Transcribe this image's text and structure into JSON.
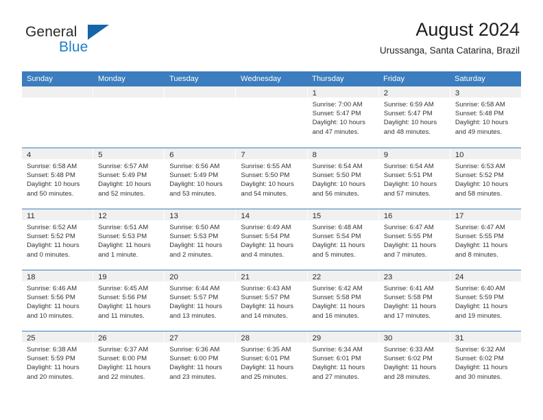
{
  "brand": {
    "general": "General",
    "blue": "Blue",
    "triangle_color": "#1565a8",
    "blue_color": "#1d7ec8"
  },
  "header": {
    "title": "August 2024",
    "subtitle": "Urussanga, Santa Catarina, Brazil",
    "accent_color": "#3b7dbe"
  },
  "weekdays": [
    "Sunday",
    "Monday",
    "Tuesday",
    "Wednesday",
    "Thursday",
    "Friday",
    "Saturday"
  ],
  "weeks": [
    [
      {
        "empty": true
      },
      {
        "empty": true
      },
      {
        "empty": true
      },
      {
        "empty": true
      },
      {
        "day": "1",
        "sunrise": "Sunrise: 7:00 AM",
        "sunset": "Sunset: 5:47 PM",
        "daylight1": "Daylight: 10 hours",
        "daylight2": "and 47 minutes."
      },
      {
        "day": "2",
        "sunrise": "Sunrise: 6:59 AM",
        "sunset": "Sunset: 5:47 PM",
        "daylight1": "Daylight: 10 hours",
        "daylight2": "and 48 minutes."
      },
      {
        "day": "3",
        "sunrise": "Sunrise: 6:58 AM",
        "sunset": "Sunset: 5:48 PM",
        "daylight1": "Daylight: 10 hours",
        "daylight2": "and 49 minutes."
      }
    ],
    [
      {
        "day": "4",
        "sunrise": "Sunrise: 6:58 AM",
        "sunset": "Sunset: 5:48 PM",
        "daylight1": "Daylight: 10 hours",
        "daylight2": "and 50 minutes."
      },
      {
        "day": "5",
        "sunrise": "Sunrise: 6:57 AM",
        "sunset": "Sunset: 5:49 PM",
        "daylight1": "Daylight: 10 hours",
        "daylight2": "and 52 minutes."
      },
      {
        "day": "6",
        "sunrise": "Sunrise: 6:56 AM",
        "sunset": "Sunset: 5:49 PM",
        "daylight1": "Daylight: 10 hours",
        "daylight2": "and 53 minutes."
      },
      {
        "day": "7",
        "sunrise": "Sunrise: 6:55 AM",
        "sunset": "Sunset: 5:50 PM",
        "daylight1": "Daylight: 10 hours",
        "daylight2": "and 54 minutes."
      },
      {
        "day": "8",
        "sunrise": "Sunrise: 6:54 AM",
        "sunset": "Sunset: 5:50 PM",
        "daylight1": "Daylight: 10 hours",
        "daylight2": "and 56 minutes."
      },
      {
        "day": "9",
        "sunrise": "Sunrise: 6:54 AM",
        "sunset": "Sunset: 5:51 PM",
        "daylight1": "Daylight: 10 hours",
        "daylight2": "and 57 minutes."
      },
      {
        "day": "10",
        "sunrise": "Sunrise: 6:53 AM",
        "sunset": "Sunset: 5:52 PM",
        "daylight1": "Daylight: 10 hours",
        "daylight2": "and 58 minutes."
      }
    ],
    [
      {
        "day": "11",
        "sunrise": "Sunrise: 6:52 AM",
        "sunset": "Sunset: 5:52 PM",
        "daylight1": "Daylight: 11 hours",
        "daylight2": "and 0 minutes."
      },
      {
        "day": "12",
        "sunrise": "Sunrise: 6:51 AM",
        "sunset": "Sunset: 5:53 PM",
        "daylight1": "Daylight: 11 hours",
        "daylight2": "and 1 minute."
      },
      {
        "day": "13",
        "sunrise": "Sunrise: 6:50 AM",
        "sunset": "Sunset: 5:53 PM",
        "daylight1": "Daylight: 11 hours",
        "daylight2": "and 2 minutes."
      },
      {
        "day": "14",
        "sunrise": "Sunrise: 6:49 AM",
        "sunset": "Sunset: 5:54 PM",
        "daylight1": "Daylight: 11 hours",
        "daylight2": "and 4 minutes."
      },
      {
        "day": "15",
        "sunrise": "Sunrise: 6:48 AM",
        "sunset": "Sunset: 5:54 PM",
        "daylight1": "Daylight: 11 hours",
        "daylight2": "and 5 minutes."
      },
      {
        "day": "16",
        "sunrise": "Sunrise: 6:47 AM",
        "sunset": "Sunset: 5:55 PM",
        "daylight1": "Daylight: 11 hours",
        "daylight2": "and 7 minutes."
      },
      {
        "day": "17",
        "sunrise": "Sunrise: 6:47 AM",
        "sunset": "Sunset: 5:55 PM",
        "daylight1": "Daylight: 11 hours",
        "daylight2": "and 8 minutes."
      }
    ],
    [
      {
        "day": "18",
        "sunrise": "Sunrise: 6:46 AM",
        "sunset": "Sunset: 5:56 PM",
        "daylight1": "Daylight: 11 hours",
        "daylight2": "and 10 minutes."
      },
      {
        "day": "19",
        "sunrise": "Sunrise: 6:45 AM",
        "sunset": "Sunset: 5:56 PM",
        "daylight1": "Daylight: 11 hours",
        "daylight2": "and 11 minutes."
      },
      {
        "day": "20",
        "sunrise": "Sunrise: 6:44 AM",
        "sunset": "Sunset: 5:57 PM",
        "daylight1": "Daylight: 11 hours",
        "daylight2": "and 13 minutes."
      },
      {
        "day": "21",
        "sunrise": "Sunrise: 6:43 AM",
        "sunset": "Sunset: 5:57 PM",
        "daylight1": "Daylight: 11 hours",
        "daylight2": "and 14 minutes."
      },
      {
        "day": "22",
        "sunrise": "Sunrise: 6:42 AM",
        "sunset": "Sunset: 5:58 PM",
        "daylight1": "Daylight: 11 hours",
        "daylight2": "and 16 minutes."
      },
      {
        "day": "23",
        "sunrise": "Sunrise: 6:41 AM",
        "sunset": "Sunset: 5:58 PM",
        "daylight1": "Daylight: 11 hours",
        "daylight2": "and 17 minutes."
      },
      {
        "day": "24",
        "sunrise": "Sunrise: 6:40 AM",
        "sunset": "Sunset: 5:59 PM",
        "daylight1": "Daylight: 11 hours",
        "daylight2": "and 19 minutes."
      }
    ],
    [
      {
        "day": "25",
        "sunrise": "Sunrise: 6:38 AM",
        "sunset": "Sunset: 5:59 PM",
        "daylight1": "Daylight: 11 hours",
        "daylight2": "and 20 minutes."
      },
      {
        "day": "26",
        "sunrise": "Sunrise: 6:37 AM",
        "sunset": "Sunset: 6:00 PM",
        "daylight1": "Daylight: 11 hours",
        "daylight2": "and 22 minutes."
      },
      {
        "day": "27",
        "sunrise": "Sunrise: 6:36 AM",
        "sunset": "Sunset: 6:00 PM",
        "daylight1": "Daylight: 11 hours",
        "daylight2": "and 23 minutes."
      },
      {
        "day": "28",
        "sunrise": "Sunrise: 6:35 AM",
        "sunset": "Sunset: 6:01 PM",
        "daylight1": "Daylight: 11 hours",
        "daylight2": "and 25 minutes."
      },
      {
        "day": "29",
        "sunrise": "Sunrise: 6:34 AM",
        "sunset": "Sunset: 6:01 PM",
        "daylight1": "Daylight: 11 hours",
        "daylight2": "and 27 minutes."
      },
      {
        "day": "30",
        "sunrise": "Sunrise: 6:33 AM",
        "sunset": "Sunset: 6:02 PM",
        "daylight1": "Daylight: 11 hours",
        "daylight2": "and 28 minutes."
      },
      {
        "day": "31",
        "sunrise": "Sunrise: 6:32 AM",
        "sunset": "Sunset: 6:02 PM",
        "daylight1": "Daylight: 11 hours",
        "daylight2": "and 30 minutes."
      }
    ]
  ]
}
